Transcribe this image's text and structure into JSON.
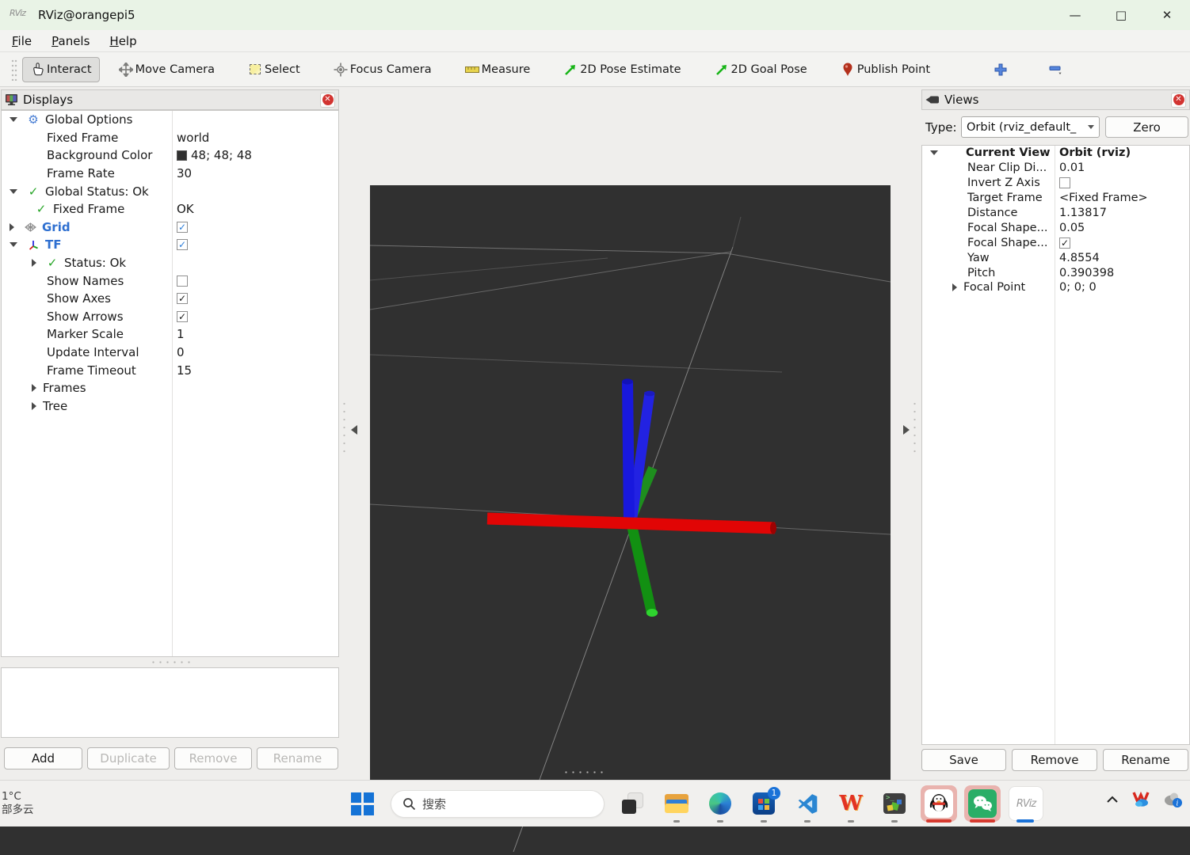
{
  "window": {
    "title": "RViz@orangepi5",
    "controls": {
      "minimize": "—",
      "maximize": "□",
      "close": "✕"
    }
  },
  "menu": {
    "items": [
      {
        "accel": "F",
        "rest": "ile"
      },
      {
        "accel": "P",
        "rest": "anels"
      },
      {
        "accel": "H",
        "rest": "elp"
      }
    ]
  },
  "toolbar": {
    "tools": [
      {
        "label": "Interact",
        "selected": true
      },
      {
        "label": "Move Camera"
      },
      {
        "label": "Select"
      },
      {
        "label": "Focus Camera"
      },
      {
        "label": "Measure"
      },
      {
        "label": "2D Pose Estimate"
      },
      {
        "label": "2D Goal Pose"
      },
      {
        "label": "Publish Point"
      }
    ],
    "add_tool": "+",
    "remove_tool": "−"
  },
  "displays": {
    "title": "Displays",
    "rows": [
      {
        "indent": 0,
        "arrow": "down",
        "icon": "gear",
        "label": "Global Options"
      },
      {
        "indent": 1,
        "label": "Fixed Frame",
        "value": {
          "type": "text",
          "text": "world"
        }
      },
      {
        "indent": 1,
        "label": "Background Color",
        "value": {
          "type": "swatch",
          "text": "48; 48; 48",
          "swatch": "#303030"
        }
      },
      {
        "indent": 1,
        "label": "Frame Rate",
        "value": {
          "type": "text",
          "text": "30"
        }
      },
      {
        "indent": 0,
        "arrow": "down",
        "icon": "check",
        "label": "Global Status: Ok"
      },
      {
        "indent": 1,
        "icon": "check",
        "label": "Fixed Frame",
        "value": {
          "type": "text",
          "text": "OK"
        }
      },
      {
        "indent": 0,
        "arrow": "right",
        "icon": "grid",
        "label": "Grid",
        "labelClass": "blue",
        "value": {
          "type": "check",
          "checked": true,
          "color": "blue"
        }
      },
      {
        "indent": 0,
        "arrow": "down",
        "icon": "tf",
        "label": "TF",
        "labelClass": "blue",
        "value": {
          "type": "check",
          "checked": true,
          "color": "blue"
        }
      },
      {
        "indent": 1,
        "arrow": "right",
        "icon": "check",
        "label": "Status: Ok"
      },
      {
        "indent": 1,
        "label": "Show Names",
        "value": {
          "type": "check",
          "checked": false
        }
      },
      {
        "indent": 1,
        "label": "Show Axes",
        "value": {
          "type": "check",
          "checked": true,
          "color": "black"
        }
      },
      {
        "indent": 1,
        "label": "Show Arrows",
        "value": {
          "type": "check",
          "checked": true,
          "color": "black"
        }
      },
      {
        "indent": 1,
        "label": "Marker Scale",
        "value": {
          "type": "text",
          "text": "1"
        }
      },
      {
        "indent": 1,
        "label": "Update Interval",
        "value": {
          "type": "text",
          "text": "0"
        }
      },
      {
        "indent": 1,
        "label": "Frame Timeout",
        "value": {
          "type": "text",
          "text": "15"
        }
      },
      {
        "indent": 1,
        "arrow": "right",
        "label": "Frames"
      },
      {
        "indent": 1,
        "arrow": "right",
        "label": "Tree"
      }
    ],
    "buttons": [
      {
        "label": "Add",
        "enabled": true
      },
      {
        "label": "Duplicate",
        "enabled": false
      },
      {
        "label": "Remove",
        "enabled": false
      },
      {
        "label": "Rename",
        "enabled": false
      }
    ]
  },
  "views": {
    "title": "Views",
    "type_label": "Type:",
    "type_value": "Orbit (rviz_default_",
    "zero_button": "Zero",
    "rows": [
      {
        "indent": 0,
        "arrow": "down",
        "label": "Current View",
        "labelClass": "bold",
        "value": {
          "type": "text",
          "text": "Orbit (rviz)",
          "bold": true
        }
      },
      {
        "indent": 1,
        "label": "Near Clip Di...",
        "value": {
          "type": "text",
          "text": "0.01"
        }
      },
      {
        "indent": 1,
        "label": "Invert Z Axis",
        "value": {
          "type": "check",
          "checked": false
        }
      },
      {
        "indent": 1,
        "label": "Target Frame",
        "value": {
          "type": "text",
          "text": "<Fixed Frame>"
        }
      },
      {
        "indent": 1,
        "label": "Distance",
        "value": {
          "type": "text",
          "text": "1.13817"
        }
      },
      {
        "indent": 1,
        "label": "Focal Shape...",
        "value": {
          "type": "text",
          "text": "0.05"
        }
      },
      {
        "indent": 1,
        "label": "Focal Shape...",
        "value": {
          "type": "check",
          "checked": true,
          "color": "black"
        }
      },
      {
        "indent": 1,
        "label": "Yaw",
        "value": {
          "type": "text",
          "text": "4.8554"
        }
      },
      {
        "indent": 1,
        "label": "Pitch",
        "value": {
          "type": "text",
          "text": "0.390398"
        }
      },
      {
        "indent": 1,
        "arrow": "right",
        "label": "Focal Point",
        "value": {
          "type": "text",
          "text": "0; 0; 0"
        }
      }
    ],
    "buttons": [
      {
        "label": "Save",
        "enabled": true
      },
      {
        "label": "Remove",
        "enabled": true
      },
      {
        "label": "Rename",
        "enabled": true
      }
    ]
  },
  "viewport": {
    "background": "#303030",
    "grid_color": "#9e9e9e",
    "axes": {
      "x_color": "#e10505",
      "y_color": "#129012",
      "z_color": "#1a1ae0"
    },
    "frames_shown": 2
  },
  "taskbar": {
    "weather": {
      "temp": "1°C",
      "condition": "部多云"
    },
    "search_placeholder": "搜索",
    "store_badge": "1",
    "rviz_tile_label": "RViz",
    "wps_label": "W"
  }
}
